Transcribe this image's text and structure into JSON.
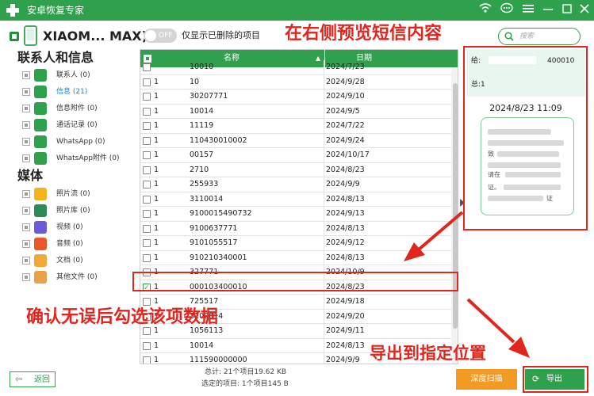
{
  "app": {
    "title": "安卓恢复专家"
  },
  "device": {
    "name": "XIAOM... MAX)"
  },
  "toggle": {
    "state": "OFF",
    "label": "仅显示已删除的项目"
  },
  "search": {
    "placeholder": "搜索"
  },
  "sidebar": {
    "section1": "联系人和信息",
    "section2": "媒体",
    "items": [
      {
        "label": "联系人 (0)",
        "icon": "contacts-icon",
        "color": "#2fa04c"
      },
      {
        "label": "信息 (21)",
        "icon": "messages-icon",
        "color": "#2fa04c",
        "active": true
      },
      {
        "label": "信息附件 (0)",
        "icon": "message-attachment-icon",
        "color": "#2fa04c"
      },
      {
        "label": "通话记录 (0)",
        "icon": "call-log-icon",
        "color": "#2fa04c"
      },
      {
        "label": "WhatsApp (0)",
        "icon": "whatsapp-icon",
        "color": "#2fa04c"
      },
      {
        "label": "WhatsApp附件 (0)",
        "icon": "whatsapp-attachment-icon",
        "color": "#2fa04c"
      },
      {
        "label": "照片流 (0)",
        "icon": "photo-stream-icon",
        "color": "#f2b31c"
      },
      {
        "label": "照片库 (0)",
        "icon": "photo-library-icon",
        "color": "#2e8b57"
      },
      {
        "label": "视频 (0)",
        "icon": "video-icon",
        "color": "#6b5bd6"
      },
      {
        "label": "音频 (0)",
        "icon": "audio-icon",
        "color": "#e9572d"
      },
      {
        "label": "文档 (0)",
        "icon": "document-icon",
        "color": "#f0a83a"
      },
      {
        "label": "其他文件 (0)",
        "icon": "other-files-icon",
        "color": "#e8a24a"
      }
    ]
  },
  "table": {
    "col_name": "名称",
    "col_date": "日期",
    "rows": [
      {
        "c1": "",
        "name": "10010",
        "date": "2024/7/23"
      },
      {
        "c1": "1",
        "name": "10",
        "date": "2024/9/28"
      },
      {
        "c1": "1",
        "name": "30207771",
        "date": "2024/9/10"
      },
      {
        "c1": "1",
        "name": "10014",
        "date": "2024/9/5"
      },
      {
        "c1": "1",
        "name": "11119",
        "date": "2024/7/22"
      },
      {
        "c1": "1",
        "name": "110430010002",
        "date": "2024/9/24"
      },
      {
        "c1": "1",
        "name": "00157",
        "date": "2024/10/17"
      },
      {
        "c1": "1",
        "name": "2710",
        "date": "2024/8/23"
      },
      {
        "c1": "1",
        "name": "255933",
        "date": "2024/9/9"
      },
      {
        "c1": "1",
        "name": "3110014",
        "date": "2024/8/13"
      },
      {
        "c1": "1",
        "name": "9100015490732",
        "date": "2024/9/13"
      },
      {
        "c1": "1",
        "name": "9100637771",
        "date": "2024/8/13"
      },
      {
        "c1": "1",
        "name": "9101055517",
        "date": "2024/9/12"
      },
      {
        "c1": "1",
        "name": "910210340001",
        "date": "2024/8/13"
      },
      {
        "c1": "1",
        "name": "327771",
        "date": "2024/10/9"
      },
      {
        "c1": "1",
        "name": "000103400010",
        "date": "2024/8/23",
        "checked": true
      },
      {
        "c1": "1",
        "name": "725517",
        "date": "2024/9/18"
      },
      {
        "c1": "1",
        "name": "3100014",
        "date": "2024/9/20"
      },
      {
        "c1": "1",
        "name": "1056113",
        "date": "2024/9/11"
      },
      {
        "c1": "1",
        "name": "10014",
        "date": "2024/8/13"
      },
      {
        "c1": "1",
        "name": "111590000000",
        "date": "2024/9/9"
      }
    ]
  },
  "preview": {
    "to_label": "给:",
    "to_number": "400010",
    "total_label": "总:1",
    "time": "2024/8/23 11:09",
    "body_fragments": [
      "致",
      "请在",
      "证。",
      "证"
    ]
  },
  "annotations": {
    "preview_note": "在右侧预览短信内容",
    "check_note": "确认无误后勾选该项数据",
    "export_note": "导出到指定位置"
  },
  "footer": {
    "back_label": "返回",
    "total": "总计: 21个项目19.62 KB",
    "selected": "选定的项目: 1个项目145 B",
    "deep_scan": "深度扫描",
    "export": "导出"
  },
  "colors": {
    "brand_green": "#2fa04c",
    "annotation_red": "#e0261f",
    "deep_scan_orange": "#f39a22"
  }
}
